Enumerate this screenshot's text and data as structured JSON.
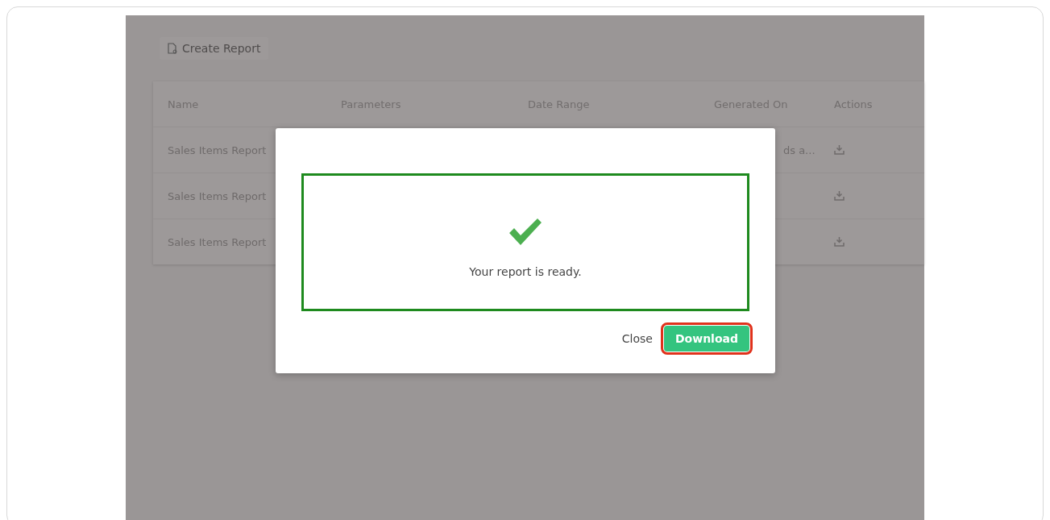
{
  "toolbar": {
    "create_button": "Create Report"
  },
  "table": {
    "columns": [
      "Name",
      "Parameters",
      "Date Range",
      "Generated On",
      "Actions"
    ],
    "rows": [
      {
        "name": "Sales Items Report",
        "generated_on": "ds a..."
      },
      {
        "name": "Sales Items Report"
      },
      {
        "name": "Sales Items Report"
      }
    ]
  },
  "dialog": {
    "message": "Your report is ready.",
    "buttons": [
      {
        "label": "Close",
        "kind": "text",
        "highlighted": false
      },
      {
        "label": "Download",
        "kind": "primary",
        "highlighted": true
      }
    ]
  }
}
